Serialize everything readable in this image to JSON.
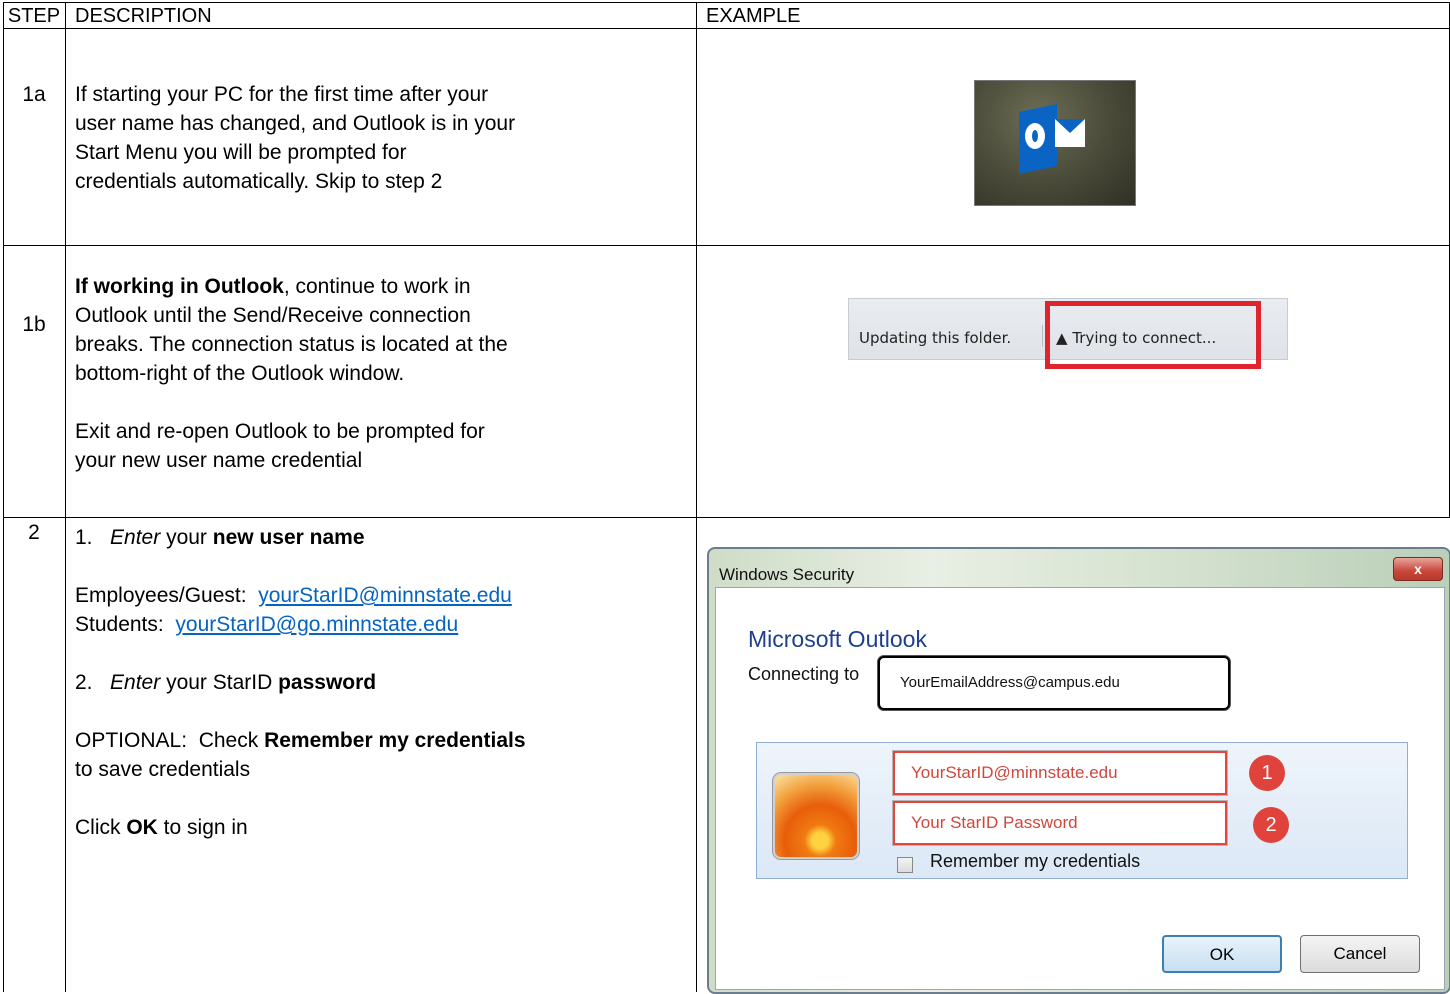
{
  "header": {
    "step": "STEP",
    "description": "DESCRIPTION",
    "example": "EXAMPLE"
  },
  "rows": [
    {
      "step": "1a",
      "lines": [
        "If starting your PC for the first time after your",
        "user name has changed, and Outlook is in your",
        "Start Menu you will be prompted for",
        "credentials automatically. Skip to step 2"
      ]
    },
    {
      "step": "1b",
      "bold_lead": "If working in Outlook",
      "lead_rest": ", continue to work in",
      "lines": [
        "Outlook until the Send/Receive connection",
        "breaks. The connection status is located at the",
        "bottom-right of the Outlook window."
      ],
      "lines2": [
        "Exit and re-open Outlook to be prompted for",
        "your new user name credential"
      ]
    },
    {
      "step": "2",
      "item1_num": "1.",
      "item1_verb": "Enter",
      "item1_mid": " your ",
      "item1_bold": "new user name",
      "employees_label": "Employees/Guest:  ",
      "employees_link": "yourStarID@minnstate.edu",
      "students_label": "Students:  ",
      "students_link": "yourStarID@go.minnstate.edu",
      "item2_num": "2.",
      "item2_verb": "Enter",
      "item2_mid": " your StarID ",
      "item2_bold": "password",
      "optional_lead": "OPTIONAL:  Check ",
      "optional_bold": "Remember my credentials",
      "optional_rest": "to save credentials",
      "click_lead": "Click ",
      "click_bold": "OK",
      "click_rest": " to sign in"
    }
  ],
  "status_bar": {
    "updating": "Updating this folder.",
    "trying": "Trying to connect...",
    "warning_icon": "warning-triangle-icon",
    "highlight_color": "#e0242e"
  },
  "dialog": {
    "title": "Windows Security",
    "close": "x",
    "app_name": "Microsoft Outlook",
    "connecting_label": "Connecting to",
    "email_address": "YourEmailAddress@campus.edu",
    "username_value": "YourStarID@minnstate.edu",
    "password_value": "Your StarID Password",
    "badge1": "1",
    "badge2": "2",
    "remember_label": "Remember my credentials",
    "ok_label": "OK",
    "cancel_label": "Cancel",
    "app_color": "#1e3f8c",
    "badge_color": "#e0433c"
  }
}
